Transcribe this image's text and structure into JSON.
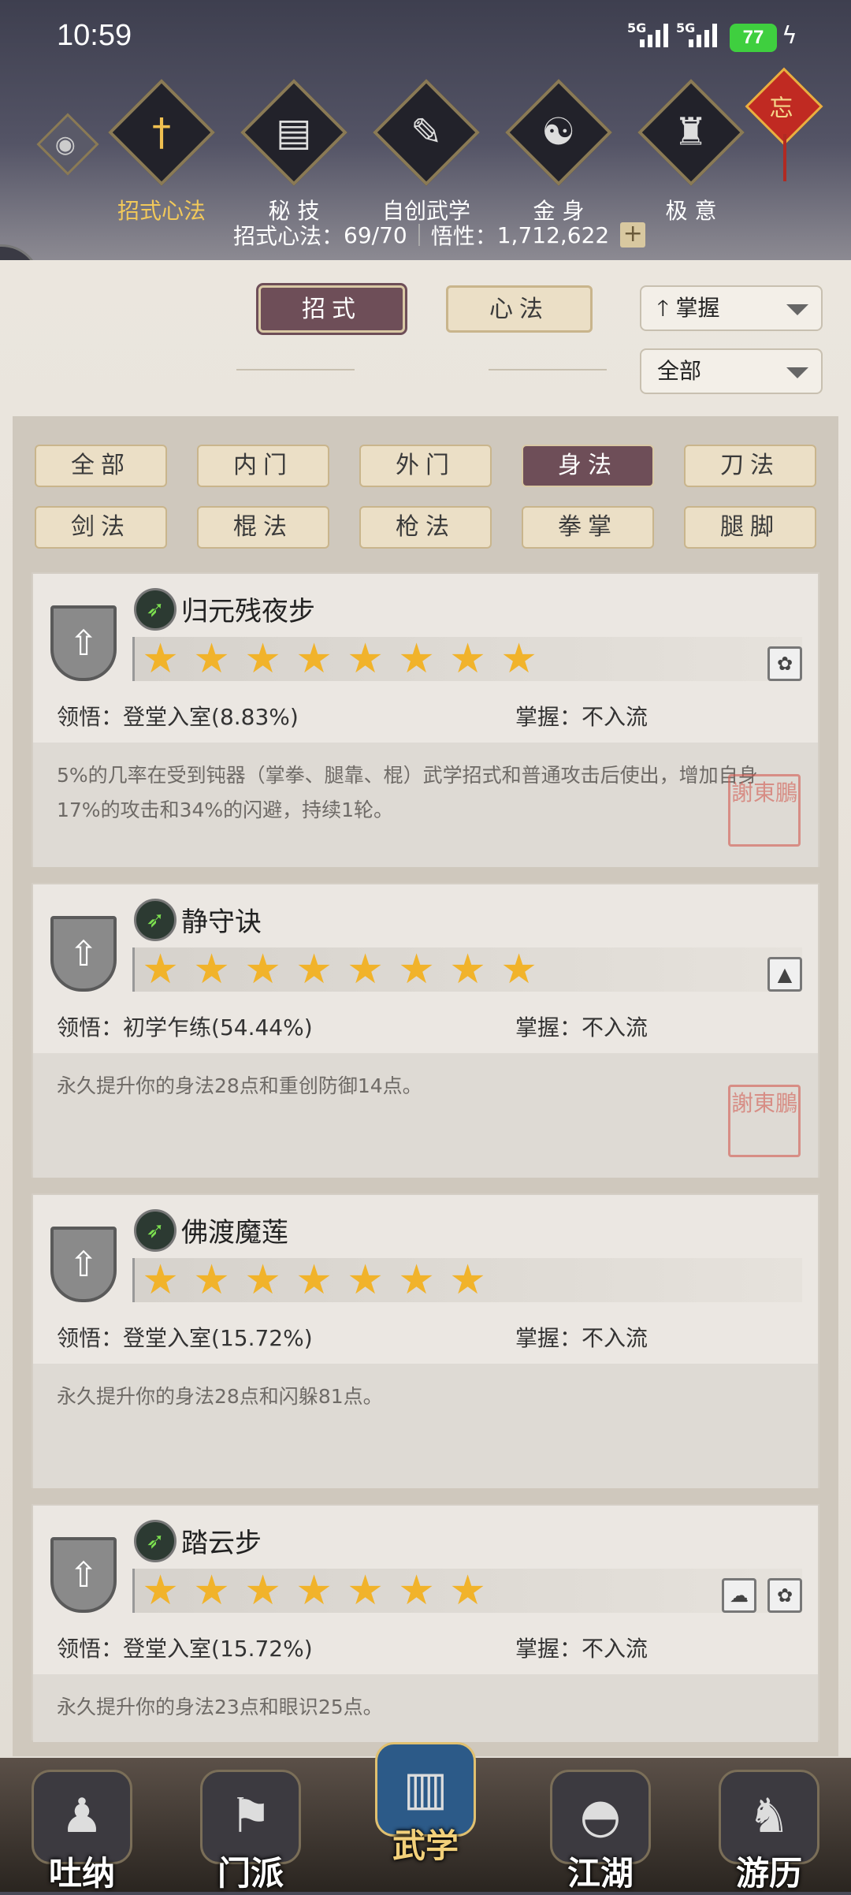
{
  "status_bar": {
    "time": "10:59",
    "network1": "5G",
    "network2": "5G",
    "battery": "77"
  },
  "top_nav": [
    {
      "label": "招式心法",
      "icon": "sword-icon",
      "active": true
    },
    {
      "label": "秘 技",
      "icon": "book-icon"
    },
    {
      "label": "自创武学",
      "icon": "scroll-icon"
    },
    {
      "label": "金 身",
      "icon": "meditation-icon"
    },
    {
      "label": "极 意",
      "icon": "martial-pose-icon"
    }
  ],
  "stats": {
    "moves_label": "招式心法：",
    "moves_value": "69/70",
    "insight_label": "悟性：",
    "insight_value": "1,712,622",
    "plus": "+"
  },
  "knot_char": "忘",
  "tabs": {
    "moves": "招式",
    "heart": "心法"
  },
  "sort_select": "掌握",
  "filter_select": "全部",
  "chips": [
    "全部",
    "内门",
    "外门",
    "身法",
    "刀法",
    "剑法",
    "棍法",
    "枪法",
    "拳掌",
    "腿脚"
  ],
  "selected_chip": "身法",
  "cards": [
    {
      "name": "归元残夜步",
      "stars": 8,
      "comprehension_label": "领悟：",
      "comprehension": "登堂入室(8.83%)",
      "mastery_label": "掌握：",
      "mastery": "不入流",
      "desc": "5%的几率在受到钝器（掌拳、腿靠、棍）武学招式和普通攻击后使出，增加自身17%的攻击和34%的闪避，持续1轮。",
      "tags": [
        "swirl-icon"
      ]
    },
    {
      "name": "静守诀",
      "stars": 8,
      "comprehension_label": "领悟：",
      "comprehension": "初学乍练(54.44%)",
      "mastery_label": "掌握：",
      "mastery": "不入流",
      "desc": "永久提升你的身法28点和重创防御14点。",
      "tags": [
        "mountain-icon"
      ]
    },
    {
      "name": "佛渡魔莲",
      "stars": 7,
      "comprehension_label": "领悟：",
      "comprehension": "登堂入室(15.72%)",
      "mastery_label": "掌握：",
      "mastery": "不入流",
      "desc": "永久提升你的身法28点和闪躲81点。",
      "tags": []
    },
    {
      "name": "踏云步",
      "stars": 7,
      "comprehension_label": "领悟：",
      "comprehension": "登堂入室(15.72%)",
      "mastery_label": "掌握：",
      "mastery": "不入流",
      "desc": "永久提升你的身法23点和眼识25点。",
      "tags": [
        "cloud-icon",
        "swirl-icon"
      ]
    }
  ],
  "stamp_text": "謝東鵬",
  "bottom_nav": [
    {
      "label": "吐纳",
      "icon": "figure-icon"
    },
    {
      "label": "门派",
      "icon": "flags-icon"
    },
    {
      "label": "武学",
      "icon": "manual-icon",
      "active": true
    },
    {
      "label": "江湖",
      "icon": "straw-hat-icon"
    },
    {
      "label": "游历",
      "icon": "horse-icon"
    }
  ]
}
